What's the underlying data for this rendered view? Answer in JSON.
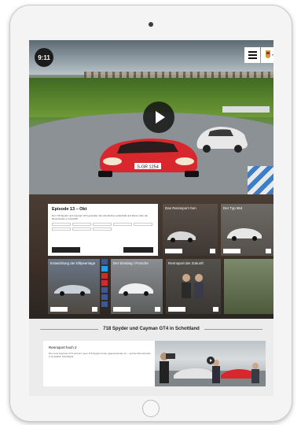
{
  "hero": {
    "time_badge": "9:11",
    "plate": "S-GR 1254",
    "menu_icon": "hamburger-icon",
    "play_icon": "play-icon"
  },
  "episode": {
    "title": "Episode 13 – Okt",
    "text": "Der 718 Spyder und Cayman GT4 genießen die schottische Landschaft und fahren über die Rennstrecke in Knockhill",
    "tags": [
      "",
      "",
      "",
      "",
      "",
      "",
      "",
      "",
      ""
    ],
    "btn_left": "",
    "btn_right": ""
  },
  "tiles": [
    {
      "label": "Das Rennsport Gen"
    },
    {
      "label": "Der Typ 964"
    },
    {
      "label": "Entwicklung der Ellipsenlage"
    },
    {
      "label": "Der Einstieg / Porsche"
    },
    {
      "label": "Rennsport der Zukunft"
    }
  ],
  "section": {
    "title": "718 Spyder und Cayman GT4 in Schottland"
  },
  "teaser": {
    "title": "Rennsport hoch 2",
    "text": "Der neue Cayman GT4 und der neue 718 Spyder treten gegeneinander an – auf der Rennstrecke in Knockhill, Schottland."
  },
  "colors": {
    "accent_red": "#d8282e",
    "share_blue": "#3b5998"
  }
}
